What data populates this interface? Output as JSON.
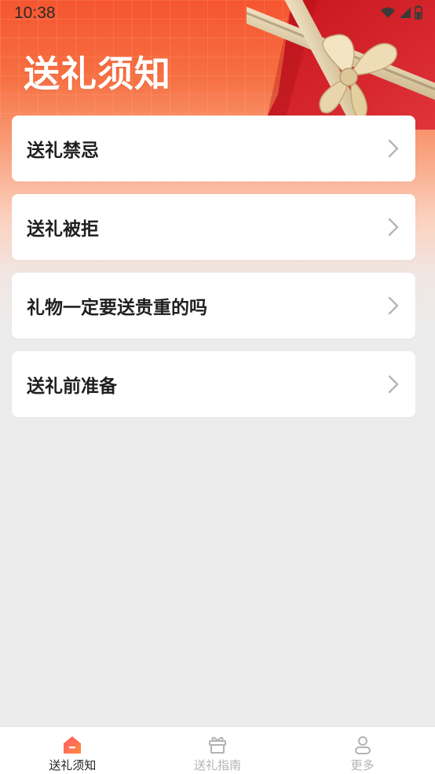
{
  "status_bar": {
    "time": "10:38"
  },
  "header": {
    "title": "送礼须知"
  },
  "menu": {
    "items": [
      {
        "label": "送礼禁忌"
      },
      {
        "label": "送礼被拒"
      },
      {
        "label": "礼物一定要送贵重的吗"
      },
      {
        "label": "送礼前准备"
      }
    ]
  },
  "tabbar": {
    "tabs": [
      {
        "label": "送礼须知",
        "icon": "home-icon",
        "active": true
      },
      {
        "label": "送礼指南",
        "icon": "gift-box-icon",
        "active": false
      },
      {
        "label": "更多",
        "icon": "user-icon",
        "active": false
      }
    ]
  },
  "colors": {
    "header_orange": "#f6552e",
    "active_icon_start": "#ff5a6a",
    "active_icon_end": "#ff8a3d",
    "inactive_text": "#b3b3b3"
  }
}
